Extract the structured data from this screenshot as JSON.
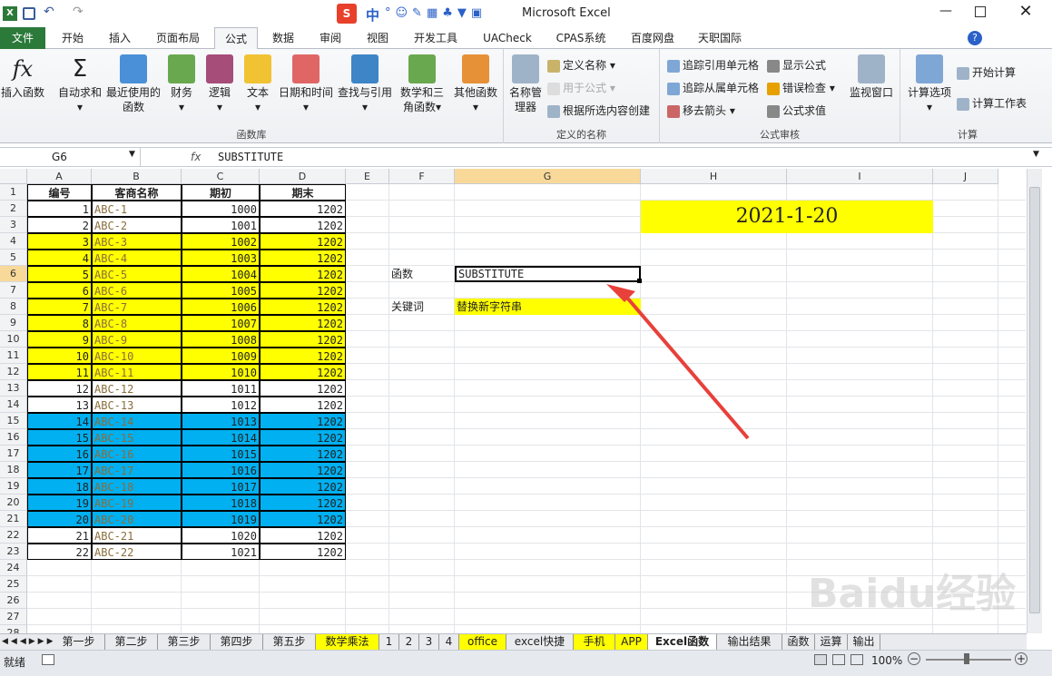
{
  "window": {
    "title": "Microsoft Excel",
    "ime_label": "中"
  },
  "ribbon_tabs": [
    "文件",
    "开始",
    "插入",
    "页面布局",
    "公式",
    "数据",
    "审阅",
    "视图",
    "开发工具",
    "UACheck",
    "CPAS系统",
    "百度网盘",
    "天职国际"
  ],
  "ribbon": {
    "function_library": {
      "label": "函数库",
      "buttons": [
        "插入函数",
        "自动求和",
        "最近使用的函数",
        "财务",
        "逻辑",
        "文本",
        "日期和时间",
        "查找与引用",
        "数学和三角函数",
        "其他函数"
      ]
    },
    "defined_names": {
      "label": "定义的名称",
      "manager": "名称管理器",
      "items": [
        "定义名称",
        "用于公式",
        "根据所选内容创建"
      ]
    },
    "auditing": {
      "label": "公式审核",
      "items": [
        "追踪引用单元格",
        "追踪从属单元格",
        "移去箭头",
        "显示公式",
        "错误检查",
        "公式求值"
      ],
      "watch": "监视窗口"
    },
    "calculation": {
      "label": "计算",
      "options": "计算选项",
      "items": [
        "开始计算",
        "计算工作表"
      ]
    }
  },
  "formula_bar": {
    "name_box": "G6",
    "fx": "fx",
    "content": "SUBSTITUTE"
  },
  "columns": [
    "A",
    "B",
    "C",
    "D",
    "E",
    "F",
    "G",
    "H",
    "I",
    "J"
  ],
  "rows": [
    "1",
    "2",
    "3",
    "4",
    "5",
    "6",
    "7",
    "8",
    "9",
    "10",
    "11",
    "12",
    "13",
    "14",
    "15",
    "16",
    "17",
    "18",
    "19",
    "20",
    "21",
    "22",
    "23",
    "24",
    "25",
    "26",
    "27",
    "28"
  ],
  "table": {
    "headers": [
      "编号",
      "客商名称",
      "期初",
      "期末"
    ],
    "rows": [
      {
        "a": "1",
        "b": "ABC-1",
        "c": "1000",
        "d": "1202",
        "color": "white"
      },
      {
        "a": "2",
        "b": "ABC-2",
        "c": "1001",
        "d": "1202",
        "color": "white"
      },
      {
        "a": "3",
        "b": "ABC-3",
        "c": "1002",
        "d": "1202",
        "color": "yellow"
      },
      {
        "a": "4",
        "b": "ABC-4",
        "c": "1003",
        "d": "1202",
        "color": "yellow"
      },
      {
        "a": "5",
        "b": "ABC-5",
        "c": "1004",
        "d": "1202",
        "color": "yellow"
      },
      {
        "a": "6",
        "b": "ABC-6",
        "c": "1005",
        "d": "1202",
        "color": "yellow"
      },
      {
        "a": "7",
        "b": "ABC-7",
        "c": "1006",
        "d": "1202",
        "color": "yellow"
      },
      {
        "a": "8",
        "b": "ABC-8",
        "c": "1007",
        "d": "1202",
        "color": "yellow"
      },
      {
        "a": "9",
        "b": "ABC-9",
        "c": "1008",
        "d": "1202",
        "color": "yellow"
      },
      {
        "a": "10",
        "b": "ABC-10",
        "c": "1009",
        "d": "1202",
        "color": "yellow"
      },
      {
        "a": "11",
        "b": "ABC-11",
        "c": "1010",
        "d": "1202",
        "color": "yellow"
      },
      {
        "a": "12",
        "b": "ABC-12",
        "c": "1011",
        "d": "1202",
        "color": "white"
      },
      {
        "a": "13",
        "b": "ABC-13",
        "c": "1012",
        "d": "1202",
        "color": "white"
      },
      {
        "a": "14",
        "b": "ABC-14",
        "c": "1013",
        "d": "1202",
        "color": "blue"
      },
      {
        "a": "15",
        "b": "ABC-15",
        "c": "1014",
        "d": "1202",
        "color": "blue"
      },
      {
        "a": "16",
        "b": "ABC-16",
        "c": "1015",
        "d": "1202",
        "color": "blue"
      },
      {
        "a": "17",
        "b": "ABC-17",
        "c": "1016",
        "d": "1202",
        "color": "blue"
      },
      {
        "a": "18",
        "b": "ABC-18",
        "c": "1017",
        "d": "1202",
        "color": "blue"
      },
      {
        "a": "19",
        "b": "ABC-19",
        "c": "1018",
        "d": "1202",
        "color": "blue"
      },
      {
        "a": "20",
        "b": "ABC-20",
        "c": "1019",
        "d": "1202",
        "color": "blue"
      },
      {
        "a": "21",
        "b": "ABC-21",
        "c": "1020",
        "d": "1202",
        "color": "white"
      },
      {
        "a": "22",
        "b": "ABC-22",
        "c": "1021",
        "d": "1202",
        "color": "white"
      }
    ]
  },
  "side": {
    "date": "2021-1-20",
    "f6": "函数",
    "g6": "SUBSTITUTE",
    "f8": "关键词",
    "g8": "替换新字符串"
  },
  "colors": {
    "yellow": "#ffff00",
    "blue": "#00b0f0",
    "white": "#ffffff",
    "arrow": "#e8403a",
    "excel_green": "#2b7a3a",
    "name_text": "#8a6d3b"
  },
  "sheet_tabs": [
    "第一步",
    "第二步",
    "第三步",
    "第四步",
    "第五步",
    "数学乘法",
    "1",
    "2",
    "3",
    "4",
    "office",
    "excel快捷",
    "手机",
    "APP",
    "Excel函数",
    "输出结果",
    "函数",
    "运算",
    "输出"
  ],
  "active_sheet": "Excel函数",
  "status": {
    "ready": "就绪",
    "zoom": "100%"
  },
  "watermark": "Baidu经验"
}
